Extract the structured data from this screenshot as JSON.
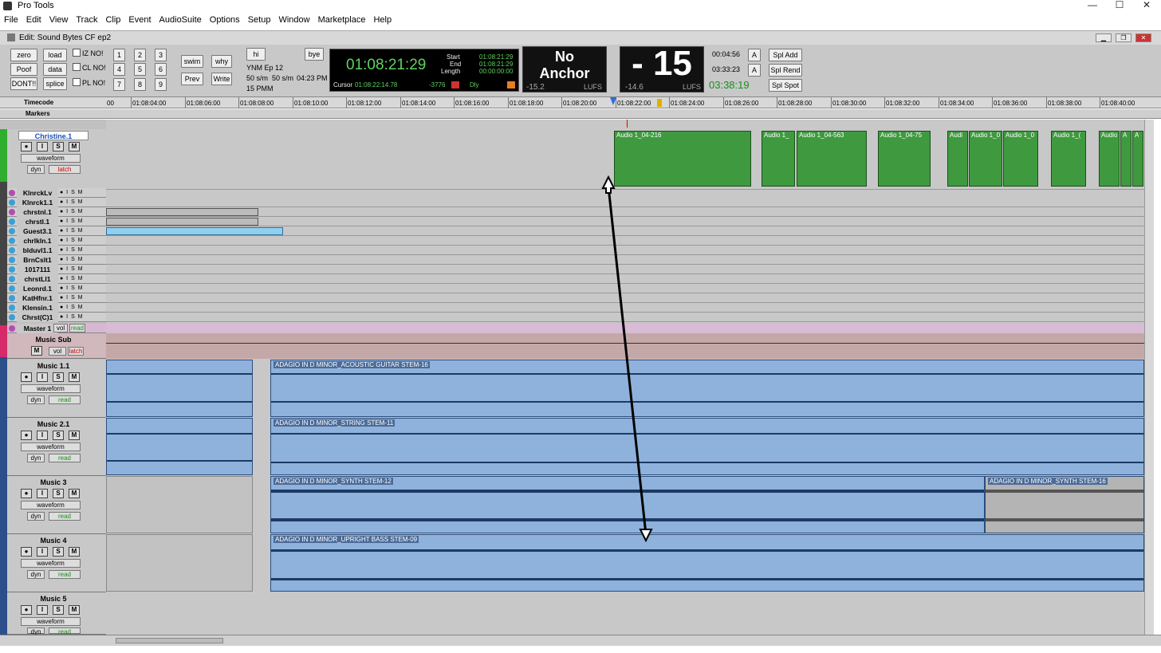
{
  "app": {
    "title": "Pro Tools",
    "window_title": "Edit: Sound Bytes CF ep2"
  },
  "window_controls": {
    "minimize": "—",
    "maximize": "☐",
    "close": "✕"
  },
  "menu": [
    "File",
    "Edit",
    "View",
    "Track",
    "Clip",
    "Event",
    "AudioSuite",
    "Options",
    "Setup",
    "Window",
    "Marketplace",
    "Help"
  ],
  "toolbar": {
    "col1": [
      "zero",
      "Poof",
      "DONT!!"
    ],
    "col2": [
      "load",
      "data",
      "splice"
    ],
    "checks": [
      "IZ  NO!",
      "CL NO!",
      "PL NO!"
    ],
    "numpad": [
      "1",
      "2",
      "3",
      "4",
      "5",
      "6",
      "7",
      "8",
      "9"
    ],
    "swim": "swim",
    "why": "why",
    "prev": "Prev",
    "write": "Write",
    "hi": "hi",
    "bye": "bye",
    "info_line1": "YNM Ep 12",
    "info_line2a": "50 s/m",
    "info_line2b": "50 s/m",
    "info_line2c": "04:23 PM",
    "info_line3": "15 PMM"
  },
  "counter": {
    "main": "01:08:21:29",
    "start_label": "Start",
    "start": "01:08:21:29",
    "end_label": "End",
    "end": "01:08:21:29",
    "length_label": "Length",
    "length": "00:00:00:00",
    "cursor_label": "Cursor",
    "cursor": "01:08:22:14.78",
    "cursor_val": "-3776",
    "dly": "Dly"
  },
  "loudness": {
    "anchor_line1": "No",
    "anchor_line2": "Anchor",
    "left_val": "-15.2",
    "left_unit": "LUFS",
    "big": "- 15",
    "right_val": "-14.6",
    "right_unit": "LUFS"
  },
  "timers": {
    "t1": "00:04:56",
    "t2": "03:33:23",
    "t3": "03:38:19",
    "a1": "A",
    "a2": "A"
  },
  "spl": [
    "Spl Add",
    "Spl Rend",
    "Spl Spot"
  ],
  "ruler": {
    "label": "Timecode",
    "ticks": [
      "00",
      "01:08:04:00",
      "01:08:06:00",
      "01:08:08:00",
      "01:08:10:00",
      "01:08:12:00",
      "01:08:14:00",
      "01:08:16:00",
      "01:08:18:00",
      "01:08:20:00",
      "01:08:22:00",
      "01:08:24:00",
      "01:08:26:00",
      "01:08:28:00",
      "01:08:30:00",
      "01:08:32:00",
      "01:08:34:00",
      "01:08:36:00",
      "01:08:38:00",
      "01:08:40:00"
    ]
  },
  "markers_label": "Markers",
  "track_main": {
    "name": "Christine.1",
    "view": "waveform",
    "dyn": "dyn",
    "mode": "latch"
  },
  "small_tracks": [
    {
      "name": "KlnrckLv",
      "color": "#b24db2"
    },
    {
      "name": "Klnrck1.1",
      "color": "#3aa0d8"
    },
    {
      "name": "chrstnl.1",
      "color": "#b24db2"
    },
    {
      "name": "chrstl.1",
      "color": "#3aa0d8"
    },
    {
      "name": "Guest3.1",
      "color": "#3aa0d8"
    },
    {
      "name": "chrlkln.1",
      "color": "#3aa0d8"
    },
    {
      "name": "blduvl1.1",
      "color": "#3aa0d8"
    },
    {
      "name": "BrnCslt1",
      "color": "#3aa0d8"
    },
    {
      "name": "1017111",
      "color": "#3aa0d8"
    },
    {
      "name": "chrstLl1",
      "color": "#3aa0d8"
    },
    {
      "name": "Leonrd.1",
      "color": "#3aa0d8"
    },
    {
      "name": "KatHfnr.1",
      "color": "#3aa0d8"
    },
    {
      "name": "Klensin.1",
      "color": "#3aa0d8"
    },
    {
      "name": "Chrst(C)1",
      "color": "#3aa0d8"
    }
  ],
  "small_ctl": "● I S M",
  "master": {
    "name": "Master 1",
    "vol": "vol",
    "mode": "read"
  },
  "music_sub": {
    "name": "Music Sub",
    "m": "M",
    "vol": "vol",
    "mode": "latch"
  },
  "music_tracks": [
    {
      "name": "Music 1.1",
      "view": "waveform",
      "dyn": "dyn",
      "mode": "read",
      "clip": "ADAGIO IN D MINOR_ACOUSTIC GUITAR STEM-16"
    },
    {
      "name": "Music 2.1",
      "view": "waveform",
      "dyn": "dyn",
      "mode": "read",
      "clip": "ADAGIO IN D MINOR_STRING STEM-11"
    },
    {
      "name": "Music 3",
      "view": "waveform",
      "dyn": "dyn",
      "mode": "read",
      "clip": "ADAGIO IN D MINOR_SYNTH STEM-12",
      "clip2": "ADAGIO IN D MINOR_SYNTH STEM-16"
    },
    {
      "name": "Music 4",
      "view": "waveform",
      "dyn": "dyn",
      "mode": "read",
      "clip": "ADAGIO IN D MINOR_UPRIGHT BASS STEM-09"
    },
    {
      "name": "Music 5",
      "view": "waveform",
      "dyn": "dyn",
      "mode": "read"
    }
  ],
  "green_clips": [
    "Audio 1_04-216",
    "Audio 1_",
    "Audio 1_04-563",
    "Audio 1_04-75",
    "Audi",
    "Audio 1_0",
    "Audio 1_0",
    "Audio 1_(",
    "Audio",
    "A",
    "A"
  ],
  "buttons": {
    "i": "I",
    "s": "S",
    "m": "M"
  }
}
